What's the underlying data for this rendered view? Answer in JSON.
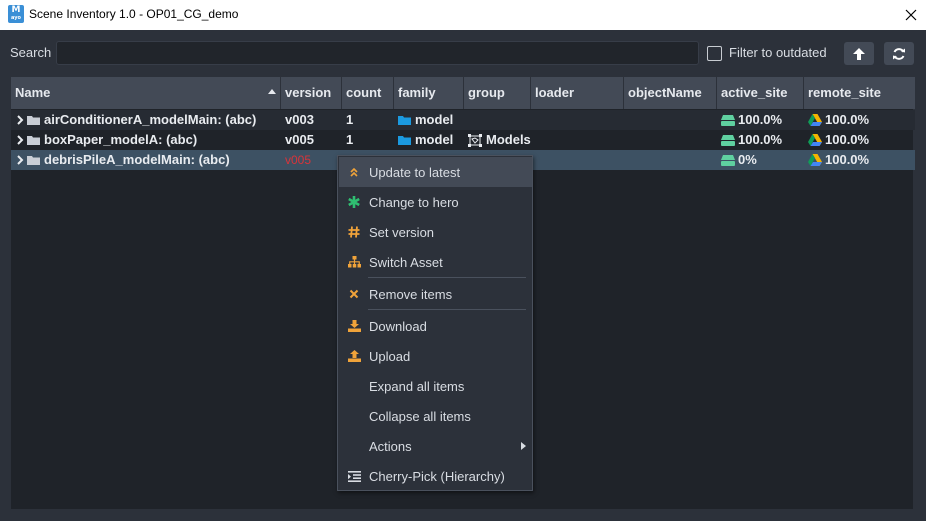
{
  "window": {
    "title": "Scene Inventory 1.0 - OP01_CG_demo",
    "app_icon_letter": "M",
    "app_icon_sub": "ayo"
  },
  "search": {
    "label": "Search",
    "value": "",
    "placeholder": ""
  },
  "filter": {
    "label": "Filter to outdated",
    "checked": false
  },
  "toolbar": {
    "up_icon": "arrow-up-icon",
    "refresh_icon": "refresh-icon"
  },
  "table": {
    "columns": [
      "Name",
      "version",
      "count",
      "family",
      "group",
      "loader",
      "objectName",
      "active_site",
      "remote_site"
    ],
    "rows": [
      {
        "name": "airConditionerA_modelMain: (abc)",
        "version": "v003",
        "count": "1",
        "family": "model",
        "group": "",
        "loader": "",
        "objectName": "",
        "active_site": "100.0%",
        "remote_site": "100.0%"
      },
      {
        "name": "boxPaper_modelA: (abc)",
        "version": "v005",
        "count": "1",
        "family": "model",
        "group": "Models",
        "loader": "",
        "objectName": "",
        "active_site": "100.0%",
        "remote_site": "100.0%"
      },
      {
        "name": "debrisPileA_modelMain: (abc)",
        "version": "v005",
        "count": "",
        "family": "",
        "group": "",
        "loader": "",
        "objectName": "",
        "active_site": "0%",
        "remote_site": "100.0%"
      }
    ]
  },
  "context_menu": {
    "items": [
      {
        "label": "Update to latest",
        "icon": "double-chevron-up-icon"
      },
      {
        "label": "Change to hero",
        "icon": "asterisk-icon"
      },
      {
        "label": "Set version",
        "icon": "hash-icon"
      },
      {
        "label": "Switch Asset",
        "icon": "sitemap-icon"
      },
      {
        "label": "Remove items",
        "icon": "cross-icon"
      },
      {
        "label": "Download",
        "icon": "download-icon"
      },
      {
        "label": "Upload",
        "icon": "upload-icon"
      },
      {
        "label": "Expand all items",
        "icon": ""
      },
      {
        "label": "Collapse all items",
        "icon": ""
      },
      {
        "label": "Actions",
        "icon": ""
      },
      {
        "label": "Cherry-Pick (Hierarchy)",
        "icon": "list-indent-icon"
      }
    ]
  },
  "colors": {
    "background": "#2c313a",
    "table_bg": "#1f2329",
    "header_bg": "#434a56",
    "selected_row": "#3d5163",
    "folder_blue": "#1b9ae0",
    "outdated_red": "#d8343a",
    "menu_orange": "#f0a33a",
    "menu_green": "#2fbf71",
    "site_green": "#5fd0a0"
  }
}
